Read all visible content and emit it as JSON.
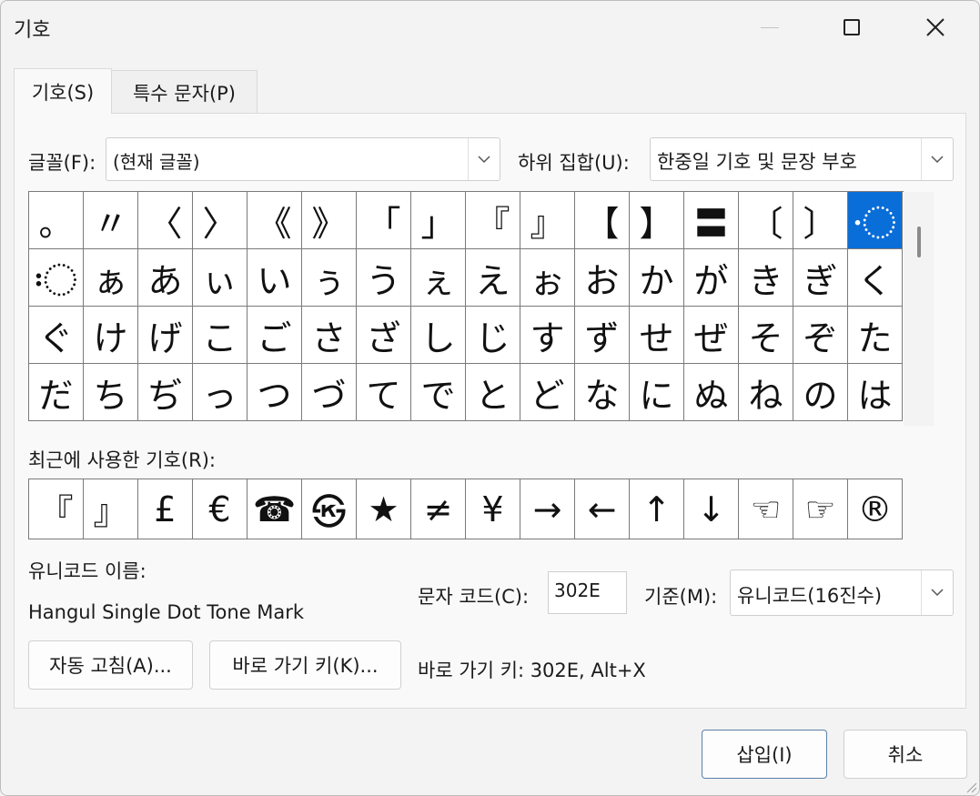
{
  "window": {
    "title": "기호",
    "minimize_icon": "minimize-icon",
    "maximize_icon": "maximize-icon",
    "close_icon": "close-icon"
  },
  "tabs": [
    {
      "label": "기호(S)",
      "selected": true
    },
    {
      "label": "특수 문자(P)",
      "selected": false
    }
  ],
  "font": {
    "label": "글꼴(F):",
    "value": "(현재 글꼴)"
  },
  "subset": {
    "label": "하위 집합(U):",
    "value": "한중일 기호 및 문장 부호"
  },
  "symbols": [
    "。",
    "〃",
    "〈",
    "〉",
    "《",
    "》",
    "「",
    "」",
    "『",
    "』",
    "【",
    "】",
    "〓",
    "〔",
    "〕",
    "〮",
    "〯",
    "ぁ",
    "あ",
    "ぃ",
    "い",
    "ぅ",
    "う",
    "ぇ",
    "え",
    "ぉ",
    "お",
    "か",
    "が",
    "き",
    "ぎ",
    "く",
    "ぐ",
    "け",
    "げ",
    "こ",
    "ご",
    "さ",
    "ざ",
    "し",
    "じ",
    "す",
    "ず",
    "せ",
    "ぜ",
    "そ",
    "ぞ",
    "た",
    "だ",
    "ち",
    "ぢ",
    "っ",
    "つ",
    "づ",
    "て",
    "で",
    "と",
    "ど",
    "な",
    "に",
    "ぬ",
    "ね",
    "の",
    "は"
  ],
  "selected_symbol": "〮",
  "recent": {
    "label": "최근에 사용한 기호(R):",
    "items": [
      "『",
      "』",
      "£",
      "€",
      "☎",
      "㉿",
      "★",
      "≠",
      "¥",
      "→",
      "←",
      "↑",
      "↓",
      "☜",
      "☞",
      "®"
    ]
  },
  "unicode_name": {
    "label": "유니코드 이름:",
    "value": "Hangul Single Dot Tone Mark"
  },
  "char_code": {
    "label": "문자 코드(C):",
    "value": "302E"
  },
  "from": {
    "label": "기준(M):",
    "value": "유니코드(16진수)"
  },
  "buttons": {
    "autocorrect": "자동 고침(A)...",
    "shortcut_key": "바로 가기 키(K)...",
    "insert": "삽입(I)",
    "cancel": "취소"
  },
  "shortcut_text": "바로 가기 키: 302E, Alt+X"
}
